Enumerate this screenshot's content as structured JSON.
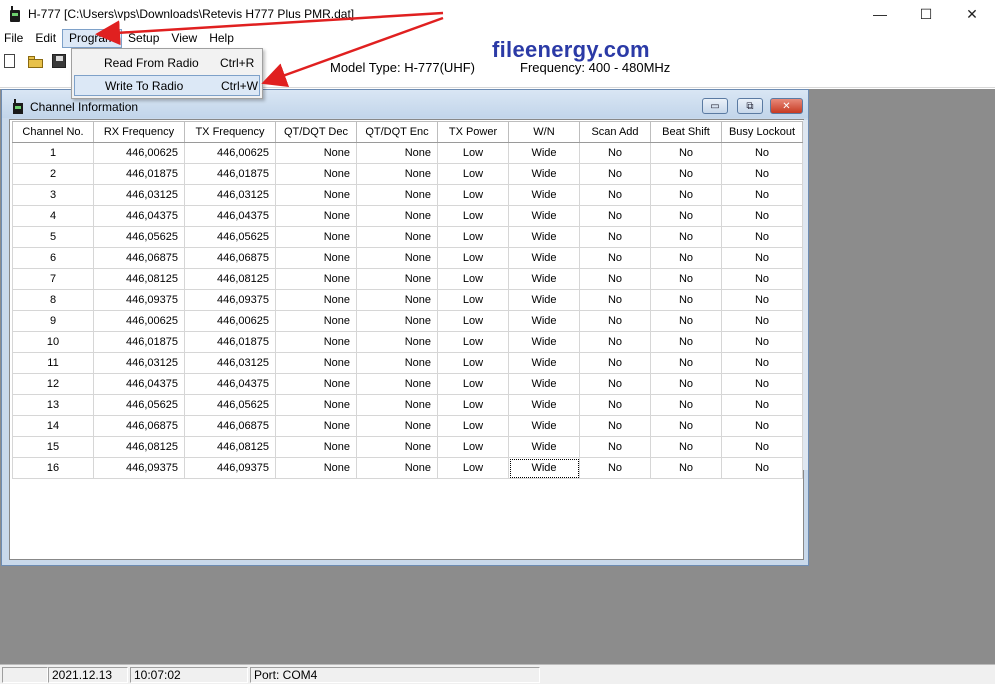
{
  "window": {
    "title": "H-777 [C:\\Users\\vps\\Downloads\\Retevis H777 Plus PMR.dat]",
    "minimize": "—",
    "maximize": "☐",
    "close": "✕"
  },
  "menu": {
    "items": [
      "File",
      "Edit",
      "Program",
      "Setup",
      "View",
      "Help"
    ],
    "active": "Program"
  },
  "dropdown": {
    "items": [
      {
        "label": "Read From Radio",
        "shortcut": "Ctrl+R"
      },
      {
        "label": "Write To Radio",
        "shortcut": "Ctrl+W"
      }
    ],
    "highlighted": "Write To Radio"
  },
  "toolbar": {
    "model_type": "Model Type:  H-777(UHF)",
    "frequency": "Frequency:  400 - 480MHz",
    "icons": [
      "new-file-icon",
      "open-folder-icon",
      "save-icon"
    ]
  },
  "watermark": "fileenergy.com",
  "channel_window": {
    "title": "Channel Information",
    "buttons": [
      "minimize",
      "restore",
      "close"
    ],
    "columns": [
      "Channel No.",
      "RX Frequency",
      "TX Frequency",
      "QT/DQT Dec",
      "QT/DQT Enc",
      "TX Power",
      "W/N",
      "Scan Add",
      "Beat Shift",
      "Busy Lockout"
    ],
    "rows": [
      [
        "1",
        "446,00625",
        "446,00625",
        "None",
        "None",
        "Low",
        "Wide",
        "No",
        "No",
        "No"
      ],
      [
        "2",
        "446,01875",
        "446,01875",
        "None",
        "None",
        "Low",
        "Wide",
        "No",
        "No",
        "No"
      ],
      [
        "3",
        "446,03125",
        "446,03125",
        "None",
        "None",
        "Low",
        "Wide",
        "No",
        "No",
        "No"
      ],
      [
        "4",
        "446,04375",
        "446,04375",
        "None",
        "None",
        "Low",
        "Wide",
        "No",
        "No",
        "No"
      ],
      [
        "5",
        "446,05625",
        "446,05625",
        "None",
        "None",
        "Low",
        "Wide",
        "No",
        "No",
        "No"
      ],
      [
        "6",
        "446,06875",
        "446,06875",
        "None",
        "None",
        "Low",
        "Wide",
        "No",
        "No",
        "No"
      ],
      [
        "7",
        "446,08125",
        "446,08125",
        "None",
        "None",
        "Low",
        "Wide",
        "No",
        "No",
        "No"
      ],
      [
        "8",
        "446,09375",
        "446,09375",
        "None",
        "None",
        "Low",
        "Wide",
        "No",
        "No",
        "No"
      ],
      [
        "9",
        "446,00625",
        "446,00625",
        "None",
        "None",
        "Low",
        "Wide",
        "No",
        "No",
        "No"
      ],
      [
        "10",
        "446,01875",
        "446,01875",
        "None",
        "None",
        "Low",
        "Wide",
        "No",
        "No",
        "No"
      ],
      [
        "11",
        "446,03125",
        "446,03125",
        "None",
        "None",
        "Low",
        "Wide",
        "No",
        "No",
        "No"
      ],
      [
        "12",
        "446,04375",
        "446,04375",
        "None",
        "None",
        "Low",
        "Wide",
        "No",
        "No",
        "No"
      ],
      [
        "13",
        "446,05625",
        "446,05625",
        "None",
        "None",
        "Low",
        "Wide",
        "No",
        "No",
        "No"
      ],
      [
        "14",
        "446,06875",
        "446,06875",
        "None",
        "None",
        "Low",
        "Wide",
        "No",
        "No",
        "No"
      ],
      [
        "15",
        "446,08125",
        "446,08125",
        "None",
        "None",
        "Low",
        "Wide",
        "No",
        "No",
        "No"
      ],
      [
        "16",
        "446,09375",
        "446,09375",
        "None",
        "None",
        "Low",
        "Wide",
        "No",
        "No",
        "No"
      ]
    ],
    "selected_cell": {
      "row": 16,
      "column": "W/N"
    }
  },
  "statusbar": {
    "date": "2021.12.13",
    "time": "10:07:02",
    "port": "Port: COM4"
  },
  "colors": {
    "annotation_arrow": "#e02020",
    "watermark": "#2b3aa6",
    "mdi_background": "#8c8c8c"
  }
}
